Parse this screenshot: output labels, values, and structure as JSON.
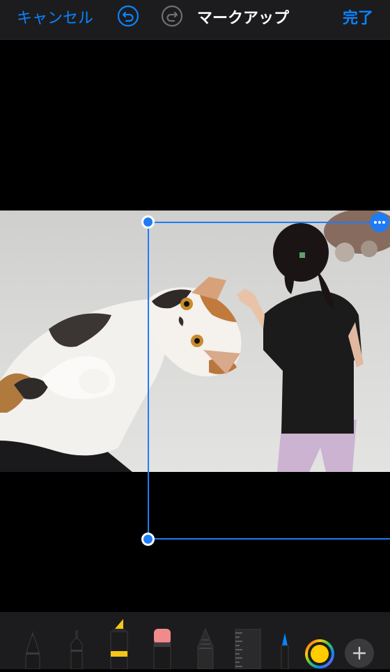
{
  "navbar": {
    "cancel_label": "キャンセル",
    "title": "マークアップ",
    "done_label": "完了",
    "undo_icon": "undo-icon",
    "redo_icon": "redo-icon"
  },
  "photo": {
    "subjects": [
      "calico-cat",
      "child-in-black-shirt"
    ]
  },
  "selection": {
    "more_icon": "ellipsis-icon"
  },
  "toolbar": {
    "tools": [
      "pen",
      "fine-liner",
      "highlighter",
      "eraser",
      "pencil",
      "ruler",
      "fountain-pen"
    ],
    "selected_color": "#ffcc00",
    "add_icon": "plus-icon"
  },
  "colors": {
    "accent": "#0a84ff",
    "selection": "#1f7cf5",
    "bar_background": "#1c1c1e"
  }
}
